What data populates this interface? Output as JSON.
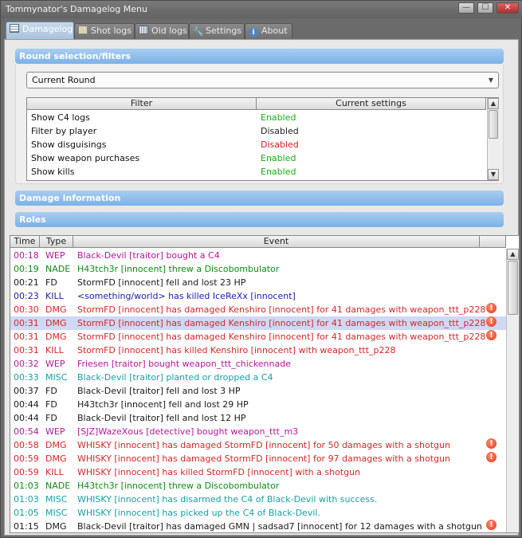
{
  "window": {
    "title": "Tommynator's Damagelog Menu"
  },
  "titlebar_buttons": {
    "minimize": "—",
    "maximize": "☐",
    "close": "✕"
  },
  "tabs": [
    {
      "label": "Damagelog",
      "icon": "table-icon",
      "active": true
    },
    {
      "label": "Shot logs",
      "icon": "notepad-icon"
    },
    {
      "label": "Old logs",
      "icon": "calendar-icon"
    },
    {
      "label": "Settings",
      "icon": "wrench-icon"
    },
    {
      "label": "About",
      "icon": "info-icon"
    }
  ],
  "sections": {
    "round_filters": "Round selection/filters",
    "damage_info": "Damage information",
    "roles": "Roles"
  },
  "round_select": {
    "value": "Current Round"
  },
  "filter_table": {
    "columns": [
      "Filter",
      "Current settings"
    ],
    "rows": [
      {
        "filter": "Show C4 logs",
        "setting": "Enabled",
        "state": "on"
      },
      {
        "filter": "Filter by player",
        "setting": "Disabled",
        "state": "off"
      },
      {
        "filter": "Show disguisings",
        "setting": "Disabled",
        "state": "red"
      },
      {
        "filter": "Show weapon purchases",
        "setting": "Enabled",
        "state": "on"
      },
      {
        "filter": "Show kills",
        "setting": "Enabled",
        "state": "on"
      }
    ]
  },
  "log_table": {
    "columns": [
      "Time",
      "Type",
      "Event",
      ""
    ],
    "rows": [
      {
        "time": "00:18",
        "type": "WEP",
        "event": "Black-Devil [traitor] bought a C4",
        "color": "#b0189c"
      },
      {
        "time": "00:19",
        "type": "NADE",
        "event": "H43tch3r [innocent] threw a Discobombulator",
        "color": "#0f8a14"
      },
      {
        "time": "00:21",
        "type": "FD",
        "event": "StormFD [innocent] fell and lost 23 HP",
        "color": "#1a1a1a"
      },
      {
        "time": "00:23",
        "type": "KILL",
        "event": "<something/world> has killed IceReXx [innocent]",
        "color": "#1c1ca8"
      },
      {
        "time": "00:30",
        "type": "DMG",
        "event": "StormFD [innocent] has damaged Kenshiro [innocent] for 41 damages with weapon_ttt_p228",
        "color": "#d22828",
        "warn": true
      },
      {
        "time": "00:31",
        "type": "DMG",
        "event": "StormFD [innocent] has damaged Kenshiro [innocent] for 41 damages with weapon_ttt_p228",
        "color": "#d22828",
        "warn": true,
        "selected": true
      },
      {
        "time": "00:31",
        "type": "DMG",
        "event": "StormFD [innocent] has damaged Kenshiro [innocent] for 41 damages with weapon_ttt_p228",
        "color": "#d22828",
        "warn": true
      },
      {
        "time": "00:31",
        "type": "KILL",
        "event": "StormFD [innocent] has killed Kenshiro [innocent] with weapon_ttt_p228",
        "color": "#d22828"
      },
      {
        "time": "00:32",
        "type": "WEP",
        "event": "Friesen [traitor] bought weapon_ttt_chickennade",
        "color": "#b0189c"
      },
      {
        "time": "00:33",
        "type": "MISC",
        "event": "Black-Devil [traitor] planted or dropped a C4",
        "color": "#179fa6"
      },
      {
        "time": "00:37",
        "type": "FD",
        "event": "Black-Devil [traitor] fell and lost 3 HP",
        "color": "#1a1a1a"
      },
      {
        "time": "00:44",
        "type": "FD",
        "event": "H43tch3r [innocent] fell and lost 29 HP",
        "color": "#1a1a1a"
      },
      {
        "time": "00:44",
        "type": "FD",
        "event": "Black-Devil [traitor] fell and lost 12 HP",
        "color": "#1a1a1a"
      },
      {
        "time": "00:54",
        "type": "WEP",
        "event": "[SJZ]WazeXous [detective] bought weapon_ttt_m3",
        "color": "#b0189c"
      },
      {
        "time": "00:58",
        "type": "DMG",
        "event": "WHISKY [innocent] has damaged StormFD [innocent] for 50 damages with a shotgun",
        "color": "#d22828",
        "warn": true
      },
      {
        "time": "00:59",
        "type": "DMG",
        "event": "WHISKY [innocent] has damaged StormFD [innocent] for 97 damages with a shotgun",
        "color": "#d22828",
        "warn": true
      },
      {
        "time": "00:59",
        "type": "KILL",
        "event": "WHISKY [innocent] has killed StormFD [innocent] with a shotgun",
        "color": "#d22828"
      },
      {
        "time": "01:03",
        "type": "NADE",
        "event": "H43tch3r [innocent] threw a Discobombulator",
        "color": "#0f8a14"
      },
      {
        "time": "01:03",
        "type": "MISC",
        "event": "WHISKY [innocent] has disarmed the C4 of Black-Devil with success.",
        "color": "#179fa6"
      },
      {
        "time": "01:05",
        "type": "MISC",
        "event": "WHISKY [innocent] has picked up the C4 of Black-Devil.",
        "color": "#179fa6"
      },
      {
        "time": "01:15",
        "type": "DMG",
        "event": "Black-Devil [traitor] has damaged GMN | sadsad7 [innocent] for 12 damages with a shotgun",
        "color": "#1a1a1a",
        "warn": true
      }
    ]
  }
}
